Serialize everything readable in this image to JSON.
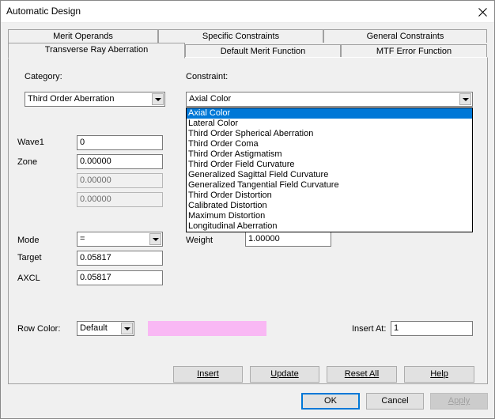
{
  "window": {
    "title": "Automatic Design"
  },
  "tabs": {
    "row_back": [
      {
        "label": "Merit Operands"
      },
      {
        "label": "Specific Constraints"
      },
      {
        "label": "General Constraints"
      }
    ],
    "row_front": [
      {
        "label": "Transverse Ray Aberration"
      },
      {
        "label": "Default Merit Function"
      },
      {
        "label": "MTF Error Function"
      }
    ]
  },
  "form": {
    "category_label": "Category:",
    "category_value": "Third Order Aberration",
    "constraint_label": "Constraint:",
    "constraint_value": "Axial Color",
    "wave_label": "Wave1",
    "wave_value": "0",
    "zone_label": "Zone",
    "zone_value": "0.00000",
    "zone2_value": "0.00000",
    "zone3_value": "0.00000",
    "weight_label": "Weight",
    "weight_value": "1.00000",
    "mode_label": "Mode",
    "mode_value": "=",
    "target_label": "Target",
    "target_value": "0.05817",
    "axcl_label": "AXCL",
    "axcl_value": "0.05817",
    "row_color_label": "Row Color:",
    "row_color_value": "Default",
    "row_color_swatch": "#f9b8f4",
    "insert_at_label": "Insert At:",
    "insert_at_value": "1"
  },
  "constraint_options": [
    "Axial Color",
    "Lateral Color",
    "Third Order Spherical Aberration",
    "Third Order Coma",
    "Third Order Astigmatism",
    "Third Order Field Curvature",
    "Generalized Sagittal Field Curvature",
    "Generalized Tangential Field Curvature",
    "Third Order Distortion",
    "Calibrated Distortion",
    "Maximum Distortion",
    "Longitudinal Aberration"
  ],
  "actions": {
    "insert": "Insert",
    "update": "Update",
    "reset_all": "Reset All",
    "help": "Help"
  },
  "dialog_buttons": {
    "ok": "OK",
    "cancel": "Cancel",
    "apply": "Apply"
  },
  "colors": {
    "selection": "#0078d7"
  }
}
